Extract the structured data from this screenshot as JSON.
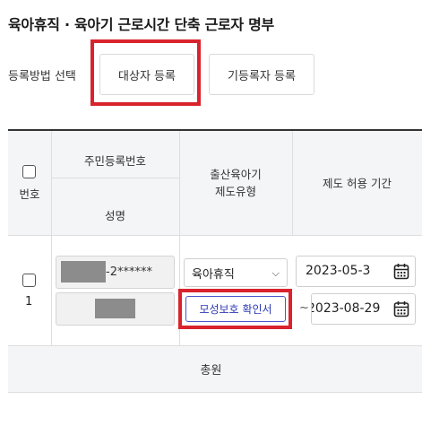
{
  "page": {
    "title": "육아휴직 · 육아기 근로시간 단축 근로자 명부"
  },
  "registration": {
    "label": "등록방법 선택",
    "target_button": "대상자 등록",
    "existing_button": "기등록자 등록"
  },
  "table": {
    "headers": {
      "number": "번호",
      "resident_number": "주민등록번호",
      "name": "성명",
      "program_type_line1": "출산육아기",
      "program_type_line2": "제도유형",
      "allowed_period": "제도 허용 기간"
    },
    "rows": [
      {
        "number": "1",
        "resident_number_suffix": "-2******",
        "program_type": "육아휴직",
        "document_button": "모성보호 확인서",
        "period_separator": "~",
        "start_date": "2023-05-3",
        "end_date": "2023-08-29"
      }
    ],
    "footer": {
      "total_label": "총원"
    }
  },
  "colors": {
    "highlight": "#d9232d",
    "document_button": "#2c39b5",
    "header_bg": "#f4f5f7"
  }
}
